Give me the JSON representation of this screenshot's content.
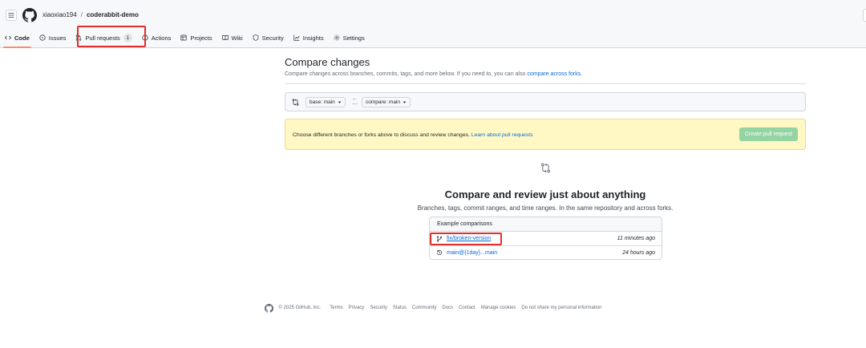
{
  "header": {
    "owner": "xiaoxiao194",
    "separator": "/",
    "repo": "coderabbit-demo"
  },
  "nav": {
    "code": "Code",
    "issues": "Issues",
    "pull_requests": "Pull requests",
    "pull_requests_count": "1",
    "actions": "Actions",
    "projects": "Projects",
    "wiki": "Wiki",
    "security": "Security",
    "insights": "Insights",
    "settings": "Settings"
  },
  "compare": {
    "title": "Compare changes",
    "subtitle_pre": "Compare changes across branches, commits, tags, and more below. If you need to, you can also ",
    "subtitle_link": "compare across forks",
    "subtitle_post": ".",
    "base_label": "base: main",
    "compare_label": "compare: main"
  },
  "flash": {
    "text": "Choose different branches or forks above to discuss and review changes. ",
    "link": "Learn about pull requests",
    "button": "Create pull request"
  },
  "blankslate": {
    "title": "Compare and review just about anything",
    "subtitle": "Branches, tags, commit ranges, and time ranges. In the same repository and across forks."
  },
  "examples": {
    "header": "Example comparisons",
    "rows": [
      {
        "ref": "fix/broken-version",
        "time": "11 minutes ago",
        "icon": "git-branch-icon"
      },
      {
        "ref": "main@{1day}...main",
        "time": "24 hours ago",
        "icon": "history-icon"
      }
    ]
  },
  "footer": {
    "copyright": "© 2025 GitHub, Inc.",
    "links": [
      "Terms",
      "Privacy",
      "Security",
      "Status",
      "Community",
      "Docs",
      "Contact",
      "Manage cookies",
      "Do not share my personal information"
    ]
  },
  "colors": {
    "accent_blue": "#0969da",
    "highlight_red": "#e0302e",
    "create_button": "#94d3a2",
    "flash_bg": "#fff8c5",
    "tab_underline": "#fd8c73"
  }
}
